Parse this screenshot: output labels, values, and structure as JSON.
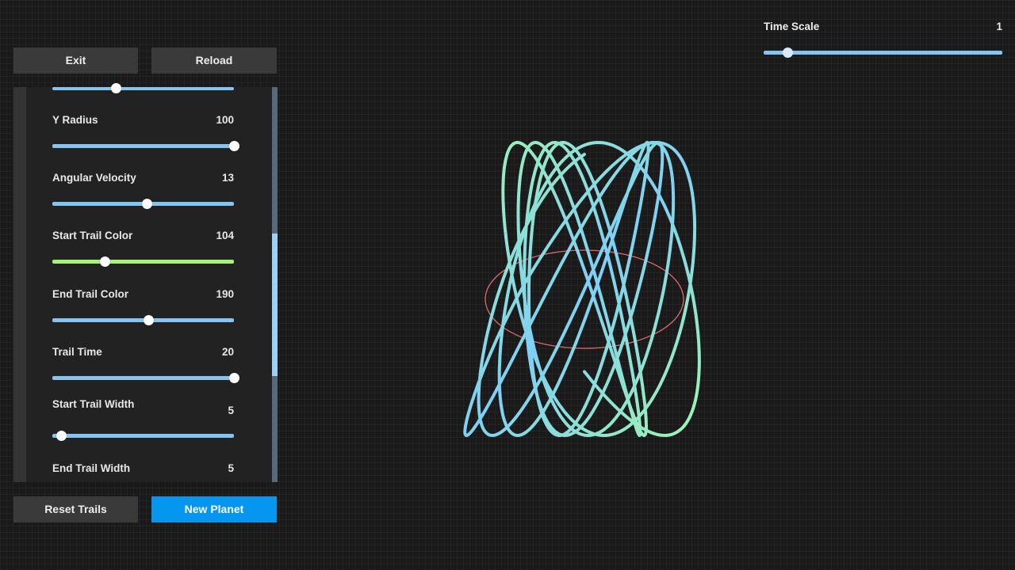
{
  "buttons": {
    "exit": "Exit",
    "reload": "Reload",
    "reset_trails": "Reset Trails",
    "new_planet": "New Planet"
  },
  "time_scale": {
    "label": "Time Scale",
    "value": "1",
    "level": 0.1
  },
  "controls": [
    {
      "label": "Y Radius",
      "value": "100",
      "level": 1.0,
      "color": "#84c5f4"
    },
    {
      "label": "Angular Velocity",
      "value": "13",
      "level": 0.52,
      "color": "#84c5f4"
    },
    {
      "label": "Start Trail Color",
      "value": "104",
      "level": 0.29,
      "color": "#a6f07c"
    },
    {
      "label": "End Trail Color",
      "value": "190",
      "level": 0.53,
      "color": "#84c5f4"
    },
    {
      "label": "Trail Time",
      "value": "20",
      "level": 1.0,
      "color": "#84c5f4"
    },
    {
      "label": "Start Trail Width",
      "value": "5",
      "level": 0.05,
      "color": "#84c5f4"
    },
    {
      "label": "End Trail Width",
      "value": "5"
    }
  ],
  "partial_top_slider_level": 0.35,
  "scroll_position": 0.58,
  "colors": {
    "background": "#1a1a1a",
    "accent": "#0596f0",
    "slider": "#84c5f4",
    "slider_green": "#a6f07c",
    "trail_green": "#9ff5b0",
    "trail_blue": "#7fd0f5",
    "orbit_red": "#e06a6a"
  }
}
